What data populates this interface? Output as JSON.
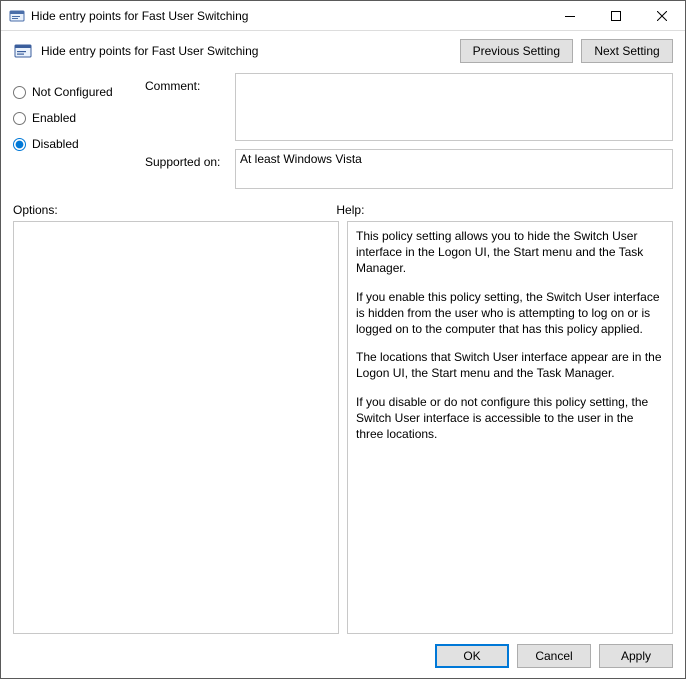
{
  "window": {
    "title": "Hide entry points for Fast User Switching"
  },
  "header": {
    "title": "Hide entry points for Fast User Switching",
    "previous_button": "Previous Setting",
    "next_button": "Next Setting"
  },
  "settings": {
    "radios": {
      "not_configured": "Not Configured",
      "enabled": "Enabled",
      "disabled": "Disabled",
      "selected": "disabled"
    },
    "comment_label": "Comment:",
    "comment_value": "",
    "supported_label": "Supported on:",
    "supported_value": "At least Windows Vista"
  },
  "sections": {
    "options_label": "Options:",
    "help_label": "Help:"
  },
  "help": {
    "p1": "This policy setting allows you to hide the Switch User interface in the Logon UI, the Start menu and the Task Manager.",
    "p2": "If you enable this policy setting, the Switch User interface is hidden from the user who is attempting to log on or is logged on to the computer that has this policy applied.",
    "p3": "The locations that Switch User interface appear are in the Logon UI, the Start menu and the Task Manager.",
    "p4": "If you disable or do not configure this policy setting, the Switch User interface is accessible to the user in the three locations."
  },
  "buttons": {
    "ok": "OK",
    "cancel": "Cancel",
    "apply": "Apply"
  }
}
